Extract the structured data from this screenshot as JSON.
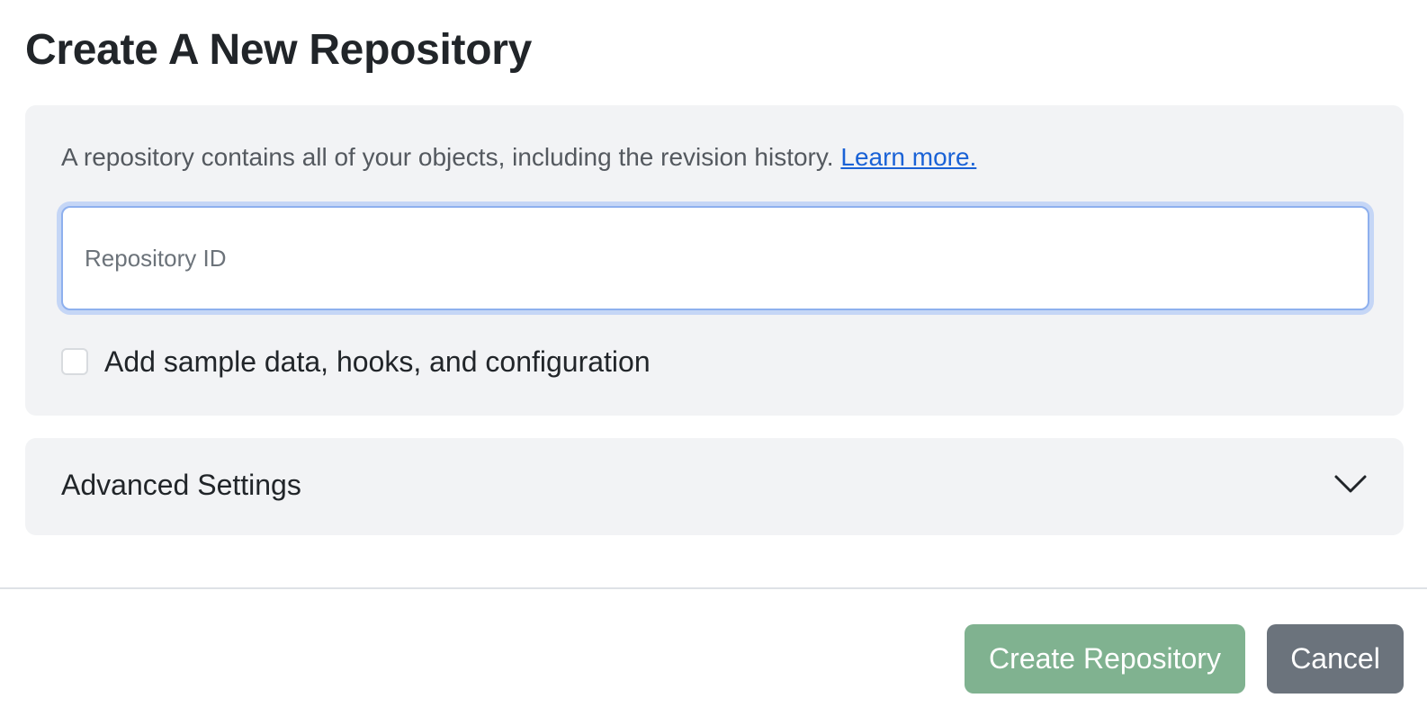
{
  "dialog": {
    "title": "Create A New Repository"
  },
  "intro": {
    "text": "A repository contains all of your objects, including the revision history.",
    "link_label": "Learn more."
  },
  "repository_id": {
    "placeholder": "Repository ID",
    "value": ""
  },
  "sample_data": {
    "label": "Add sample data, hooks, and configuration",
    "checked": false
  },
  "advanced_settings": {
    "label": "Advanced Settings",
    "icon": "chevron-down-icon",
    "expanded": false
  },
  "footer": {
    "create_label": "Create Repository",
    "cancel_label": "Cancel"
  },
  "colors": {
    "create_button": "#80b290",
    "cancel_button": "#6b737c",
    "link": "#1a62d6",
    "panel_background": "#f2f3f5",
    "input_focus_border": "#8eb0ee"
  }
}
